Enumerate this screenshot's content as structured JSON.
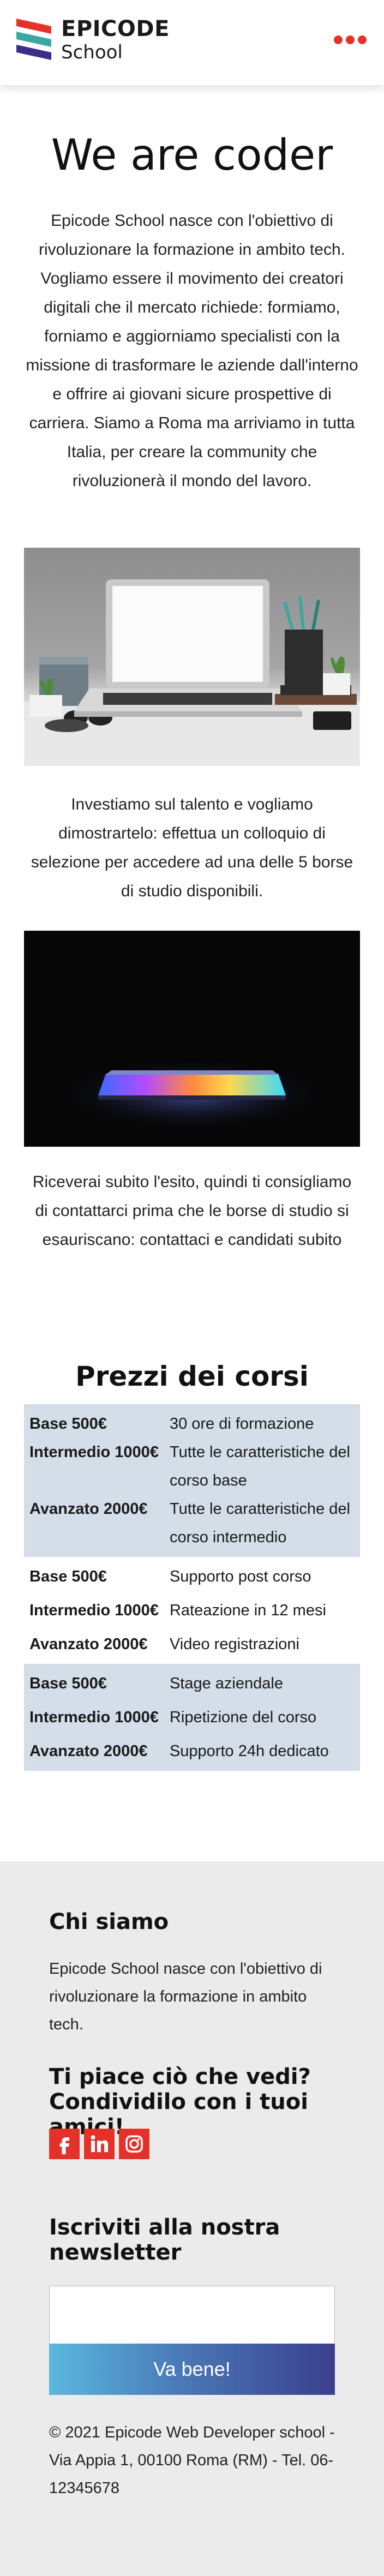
{
  "header": {
    "logo_line1": "EPICODE",
    "logo_line2": "School",
    "menu_icon": "more-dots-icon",
    "accent_color": "#e4322b"
  },
  "intro": {
    "title": "We are coder",
    "paragraph1": "Epicode School nasce con l'obiettivo di rivoluzionare la formazione in ambito tech. Vogliamo essere il movimento dei creatori digitali che il mercato richiede: formiamo, forniamo e aggiorniamo specialisti con la missione di trasformare le aziende dall'interno e offrire ai giovani sicure prospettive di carriera. Siamo a Roma ma arriviamo in tutta Italia, per creare la community che rivoluzionerà il mondo del lavoro.",
    "paragraph2": "Investiamo sul talento e vogliamo dimostrartelo: effettua un colloquio di selezione per accedere ad una delle 5 borse di studio disponibili.",
    "paragraph3": "Riceverai subito l'esito, quindi ti consigliamo di contattarci prima che le borse di studio si esauriscano: contattaci e candidati subito"
  },
  "prices": {
    "title": "Prezzi dei corsi",
    "rows": [
      {
        "plan": "Base 500€",
        "feature": "30 ore di formazione"
      },
      {
        "plan": "Intermedio 1000€",
        "feature": "Tutte le caratteristiche del corso base"
      },
      {
        "plan": "Avanzato 2000€",
        "feature": "Tutte le caratteristiche del corso intermedio"
      },
      {
        "plan": "Base 500€",
        "feature": "Supporto post corso"
      },
      {
        "plan": "Intermedio 1000€",
        "feature": "Rateazione in 12 mesi"
      },
      {
        "plan": "Avanzato 2000€",
        "feature": "Video registrazioni"
      },
      {
        "plan": "Base 500€",
        "feature": "Stage aziendale"
      },
      {
        "plan": "Intermedio 1000€",
        "feature": "Ripetizione del corso"
      },
      {
        "plan": "Avanzato 2000€",
        "feature": "Supporto 24h dedicato"
      }
    ],
    "shaded_color": "#d3dee8"
  },
  "footer": {
    "about_title": "Chi siamo",
    "about_text": "Epicode School nasce con l'obiettivo di rivoluzionare la formazione in ambito tech.",
    "share_title": "Ti piace ciò che vedi? Condividilo con i tuoi amici!",
    "socials": [
      "facebook-icon",
      "linkedin-icon",
      "instagram-icon"
    ],
    "newsletter_title": "Iscriviti alla nostra newsletter",
    "newsletter_value": "",
    "newsletter_button": "Va bene!",
    "copyright": "© 2021 Epicode Web Developer school - Via Appia 1, 00100 Roma (RM) - Tel. 06-12345678"
  }
}
